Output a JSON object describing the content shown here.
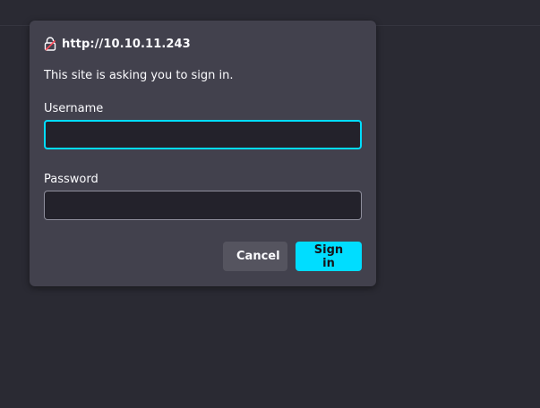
{
  "dialog": {
    "origin": "http://10.10.11.243",
    "message": "This site is asking you to sign in.",
    "username_label": "Username",
    "username_value": "",
    "password_label": "Password",
    "password_value": "",
    "cancel_label": "Cancel",
    "signin_label": "Sign in",
    "origin_icon": "lock-icon"
  },
  "colors": {
    "accent": "#00ddff",
    "dialog_bg": "#42414d",
    "page_bg": "#2a2a33",
    "lock_icon": "#ff4f5e"
  }
}
